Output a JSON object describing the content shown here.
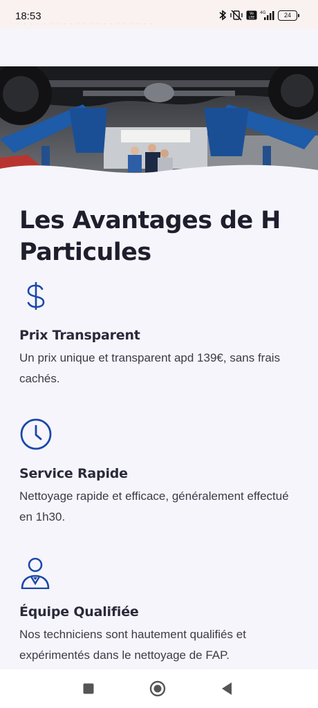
{
  "status_bar": {
    "time": "18:53",
    "battery": "24"
  },
  "hero": {
    "image": "car-underside-garage-lift-photo"
  },
  "section": {
    "title": "Les Avantages de H Particules"
  },
  "features": [
    {
      "icon": "dollar-icon",
      "title": "Prix Transparent",
      "text": "Un prix unique et transparent apd 139€, sans frais cachés."
    },
    {
      "icon": "clock-icon",
      "title": "Service Rapide",
      "text": "Nettoyage rapide et efficace, généralement effectué en 1h30."
    },
    {
      "icon": "technician-icon",
      "title": "Équipe Qualifiée",
      "text": "Nos techniciens sont hautement qualifiés et expérimentés dans le nettoyage de FAP."
    }
  ],
  "colors": {
    "accent": "#1b48a8",
    "background": "#f6f5fc",
    "heading": "#1e1e2c"
  },
  "nav": {
    "items": [
      "recents-button",
      "home-button",
      "back-button"
    ]
  }
}
